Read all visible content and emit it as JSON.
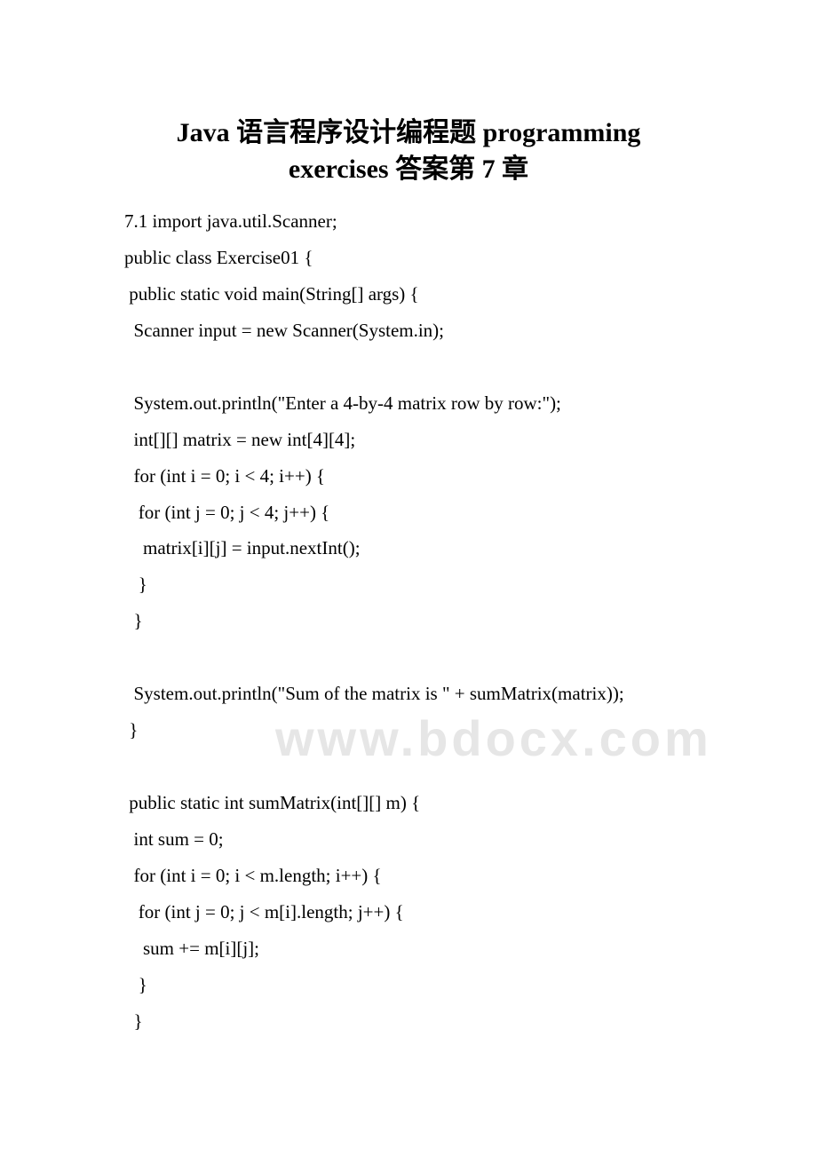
{
  "title": "Java 语言程序设计编程题 programming exercises 答案第 7 章",
  "watermark": "www.bdocx.com",
  "lines": [
    "7.1 import java.util.Scanner;",
    "public class Exercise01 {",
    " public static void main(String[] args) {",
    "  Scanner input = new Scanner(System.in);",
    "",
    "  System.out.println(\"Enter a 4-by-4 matrix row by row:\");",
    "  int[][] matrix = new int[4][4];",
    "  for (int i = 0; i < 4; i++) {",
    "   for (int j = 0; j < 4; j++) {",
    "    matrix[i][j] = input.nextInt();",
    "   }",
    "  }",
    "",
    "  System.out.println(\"Sum of the matrix is \" + sumMatrix(matrix));",
    " }",
    "",
    " public static int sumMatrix(int[][] m) {",
    "  int sum = 0;",
    "  for (int i = 0; i < m.length; i++) {",
    "   for (int j = 0; j < m[i].length; j++) {",
    "    sum += m[i][j];",
    "   }",
    "  }"
  ]
}
